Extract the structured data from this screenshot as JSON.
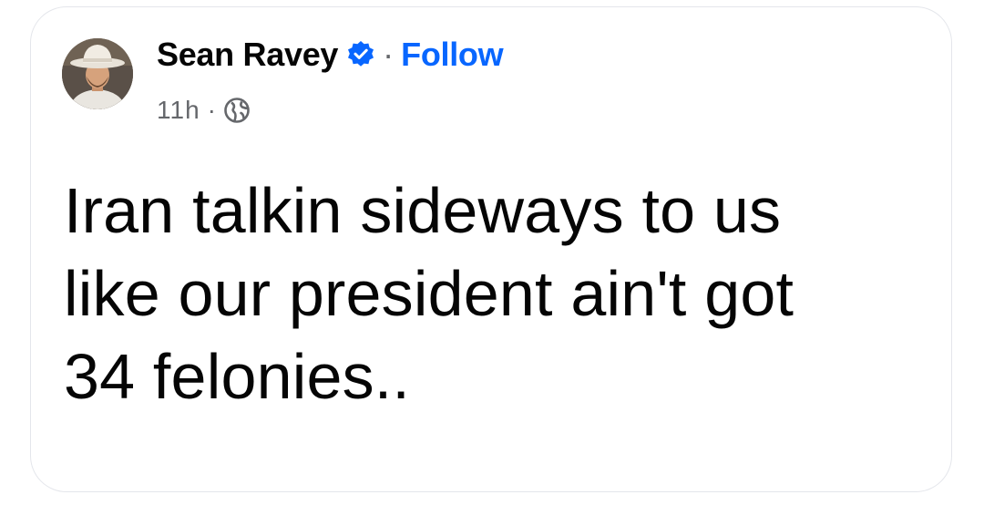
{
  "post": {
    "author": {
      "name": "Sean Ravey",
      "verified": true,
      "verified_icon": "verified-badge-icon"
    },
    "follow_label": "Follow",
    "separator": "·",
    "timestamp": "11h",
    "audience_icon": "globe-icon",
    "text_lines": [
      "Iran talkin sideways to us",
      "like our president ain't got",
      "34 felonies.."
    ]
  },
  "colors": {
    "name_text": "#050505",
    "link": "#0866ff",
    "meta": "#65676b",
    "verified_badge": "#0866ff",
    "card_border": "#e4e6eb"
  }
}
